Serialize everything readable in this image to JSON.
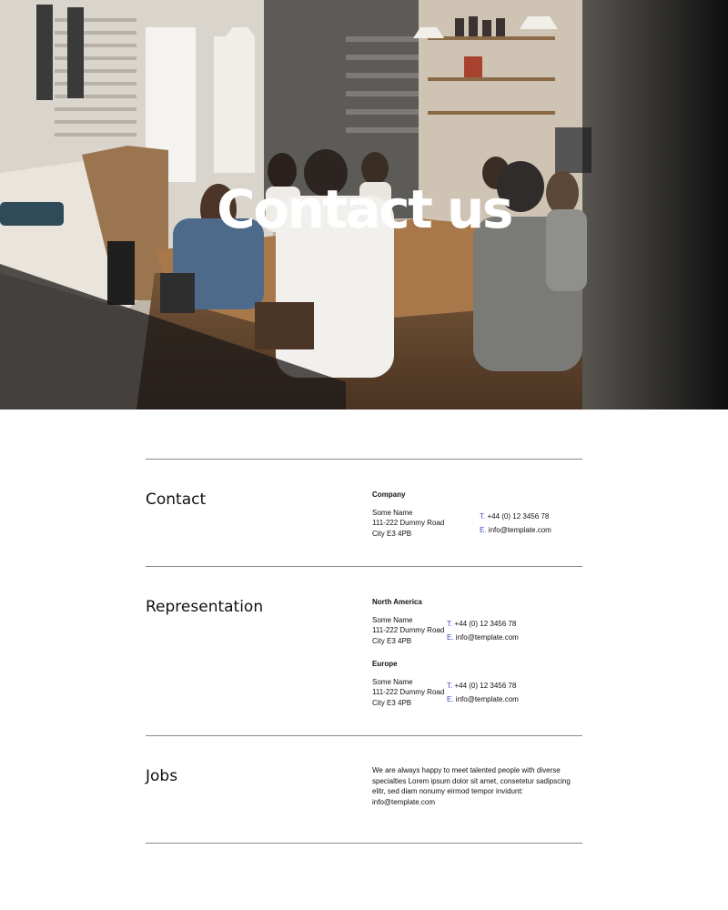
{
  "hero": {
    "title": "Contact us"
  },
  "sections": {
    "contact": {
      "title": "Contact",
      "company": {
        "label": "Company",
        "address": [
          "Some Name",
          "111-222 Dummy Road",
          "City E3 4PB"
        ],
        "phone_prefix": "T.",
        "phone": "+44 (0) 12 3456 78",
        "email_prefix": "E.",
        "email": "info@template.com"
      }
    },
    "representation": {
      "title": "Representation",
      "north_america": {
        "label": "North America",
        "address": [
          "Some Name",
          "111-222 Dummy Road",
          "City E3 4PB"
        ],
        "phone_prefix": "T.",
        "phone": "+44 (0) 12 3456 78",
        "email_prefix": "E.",
        "email": "info@template.com"
      },
      "europe": {
        "label": "Europe",
        "address": [
          "Some Name",
          "111-222 Dummy Road",
          "City E3 4PB"
        ],
        "phone_prefix": "T.",
        "phone": "+44 (0) 12 3456 78",
        "email_prefix": "E.",
        "email": "info@template.com"
      }
    },
    "jobs": {
      "title": "Jobs",
      "text": "We are always happy to meet talented people with diverse specialties Lorem ipsum dolor sit amet, consetetur sadipscing elitr, sed diam nonumy eirmod tempor invidunt:",
      "email": "info@template.com"
    }
  },
  "colors": {
    "accent": "#3b46c4",
    "divider": "#8a8a8a"
  }
}
